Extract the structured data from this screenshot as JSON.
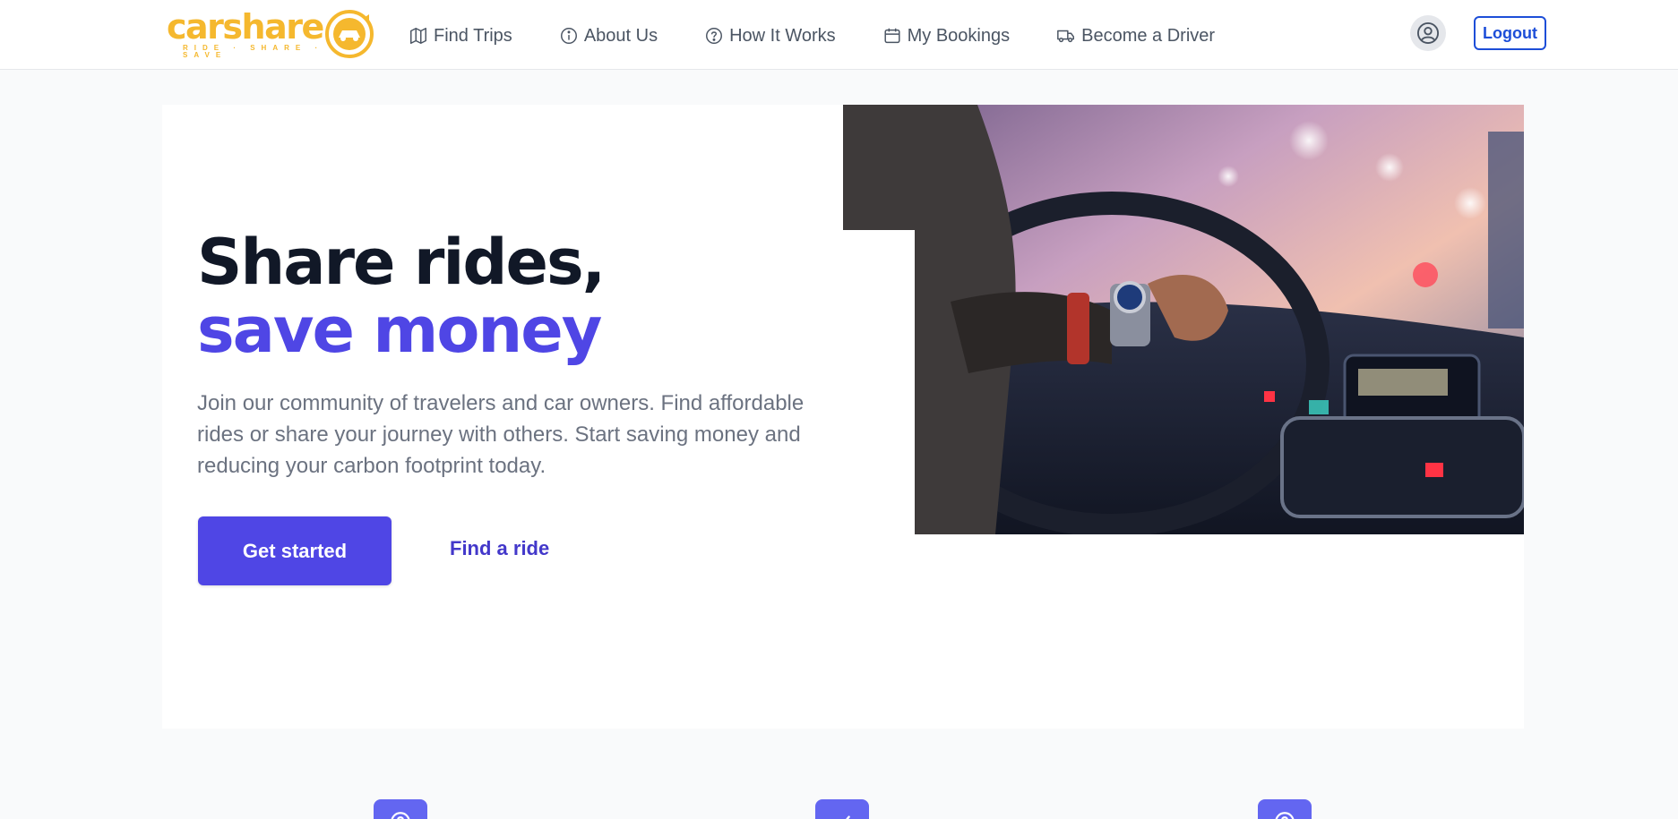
{
  "brand": {
    "name": "carshare",
    "tagline": "RIDE · SHARE · SAVE",
    "color": "#f5b82e"
  },
  "nav": {
    "items": [
      {
        "label": "Find Trips",
        "icon": "map-icon"
      },
      {
        "label": "About Us",
        "icon": "info-icon"
      },
      {
        "label": "How It Works",
        "icon": "question-icon"
      },
      {
        "label": "My Bookings",
        "icon": "calendar-icon"
      },
      {
        "label": "Become a Driver",
        "icon": "truck-icon"
      }
    ],
    "profile_icon": "user-circle-icon",
    "logout_label": "Logout"
  },
  "hero": {
    "title_main": "Share rides, ",
    "title_accent": "save money",
    "description": "Join our community of travelers and car owners. Find affordable rides or share your journey with others. Start saving money and reducing your carbon footprint today.",
    "primary_cta": "Get started",
    "secondary_cta": "Find a ride",
    "image_subject": "driver-steering-wheel-photo"
  },
  "features": {
    "icons": [
      "question-icon",
      "check-icon",
      "question-icon"
    ]
  },
  "colors": {
    "accent": "#4f46e5",
    "logout": "#1d4ed8",
    "feature_icon_bg": "#6366f1",
    "heading": "#111827",
    "body_text": "#6b7280"
  }
}
